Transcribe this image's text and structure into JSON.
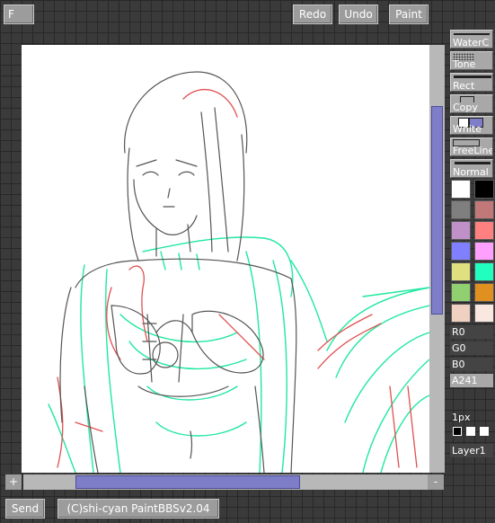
{
  "toolbar": {
    "f_label": "F",
    "redo_label": "Redo",
    "undo_label": "Undo",
    "paint_label": "Paint"
  },
  "tools": [
    {
      "label": "WaterC"
    },
    {
      "label": "Tone"
    },
    {
      "label": "Rect"
    },
    {
      "label": "Copy"
    },
    {
      "label": "White"
    },
    {
      "label": "FreeLine"
    },
    {
      "label": "Normal"
    }
  ],
  "palette": [
    "#ffffff",
    "#000000",
    "#7f7f7f",
    "#c07878",
    "#c090c8",
    "#ff8080",
    "#8080ff",
    "#ffa0ff",
    "#e0e080",
    "#20ffc0",
    "#90d070",
    "#e09020",
    "#f0d0c0",
    "#f8e8e0"
  ],
  "channels": {
    "r": "R0",
    "g": "G0",
    "b": "B0",
    "a": "A241"
  },
  "pen_size": "1px",
  "layer": "Layer1",
  "scroll": {
    "plus": "+",
    "minus": "-"
  },
  "footer": {
    "send_label": "Send",
    "credit": "(C)shi-cyan PaintBBSv2.04"
  },
  "colors": {
    "sketch": "#555555",
    "red_line": "#e05050",
    "teal_line": "#20e8a0",
    "scroll_thumb": "#7d7dc8"
  }
}
